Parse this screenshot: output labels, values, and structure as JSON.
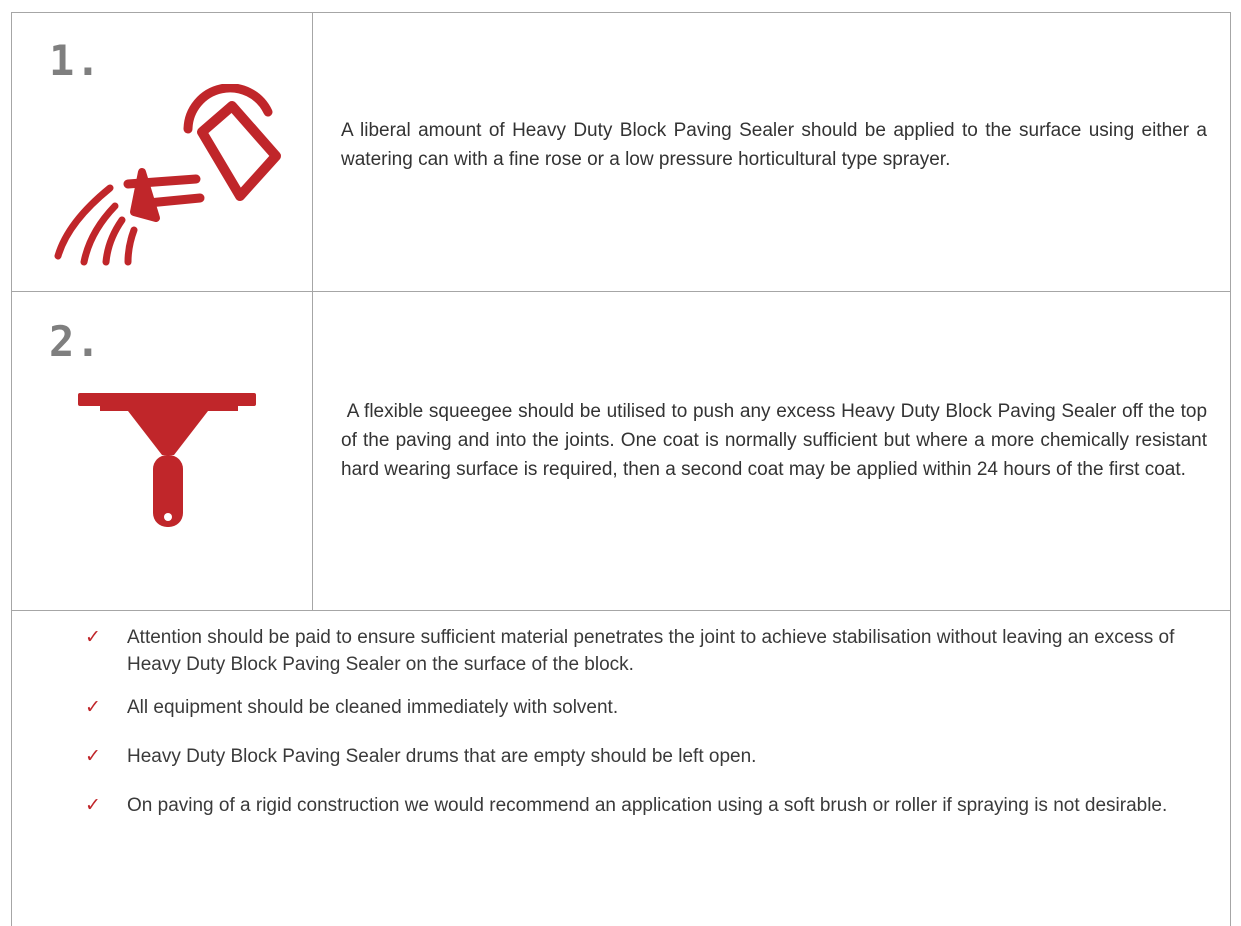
{
  "steps": [
    {
      "number": "1.",
      "icon": "watering-can-icon",
      "text": "A liberal amount of Heavy Duty Block Paving Sealer should be applied to the surface using either a watering can with a fine rose or a low pressure horticultural type sprayer."
    },
    {
      "number": "2.",
      "icon": "squeegee-icon",
      "text": " A flexible squeegee should be utilised to push any excess Heavy Duty Block Paving Sealer off the top of the paving and into the joints. One coat is normally sufficient but where a more chemically resistant hard wearing surface is required, then a second coat may be applied within 24 hours of the first coat."
    }
  ],
  "notes": [
    "Attention should be paid to ensure sufficient material penetrates the joint to achieve stabilisation without leaving an excess of Heavy Duty Block Paving Sealer on the surface of the block.",
    "All equipment should be cleaned immediately with solvent.",
    "Heavy Duty Block Paving Sealer drums that are empty should be left open.",
    "On paving of a rigid construction we would recommend an application using a soft brush or roller if spraying is not desirable."
  ],
  "check_mark": "✓",
  "colors": {
    "accent": "#c0262a",
    "number": "#7f7f7f",
    "border": "#a6a6a6",
    "text": "#333333"
  }
}
